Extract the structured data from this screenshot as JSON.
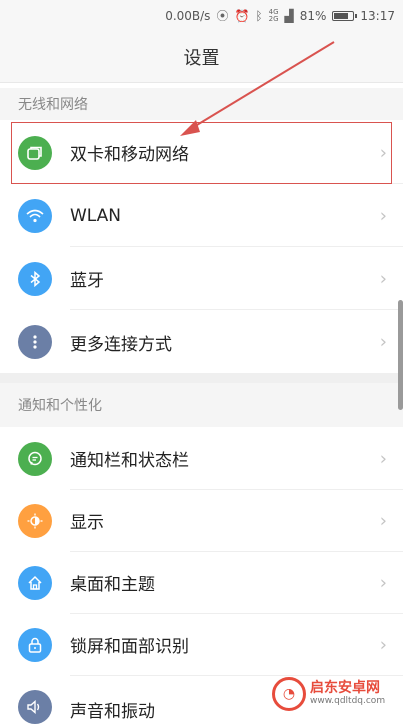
{
  "status_bar": {
    "speed": "0.00B/s",
    "network_top": "4G",
    "network_bottom": "2G",
    "battery": "81%",
    "battery_level": 0.81,
    "time": "13:17"
  },
  "header": {
    "title": "设置"
  },
  "sections": [
    {
      "title": "无线和网络",
      "items": [
        {
          "label": "双卡和移动网络",
          "icon": "dual-sim-icon",
          "color": "#4caf50"
        },
        {
          "label": "WLAN",
          "icon": "wifi-icon",
          "color": "#42a5f5"
        },
        {
          "label": "蓝牙",
          "icon": "bluetooth-icon",
          "color": "#42a5f5"
        },
        {
          "label": "更多连接方式",
          "icon": "more-icon",
          "color": "#6b7fa6"
        }
      ]
    },
    {
      "title": "通知和个性化",
      "items": [
        {
          "label": "通知栏和状态栏",
          "icon": "notification-icon",
          "color": "#4caf50"
        },
        {
          "label": "显示",
          "icon": "display-icon",
          "color": "#ffa040"
        },
        {
          "label": "桌面和主题",
          "icon": "home-icon",
          "color": "#42a5f5"
        },
        {
          "label": "锁屏和面部识别",
          "icon": "lock-icon",
          "color": "#42a5f5"
        },
        {
          "label": "声音和振动",
          "icon": "sound-icon",
          "color": "#6b7fa6"
        }
      ]
    }
  ],
  "chevron": "›",
  "watermark": {
    "name": "启东安卓网",
    "url": "www.qdltdq.com"
  },
  "colors": {
    "highlight": "#d9534f"
  }
}
